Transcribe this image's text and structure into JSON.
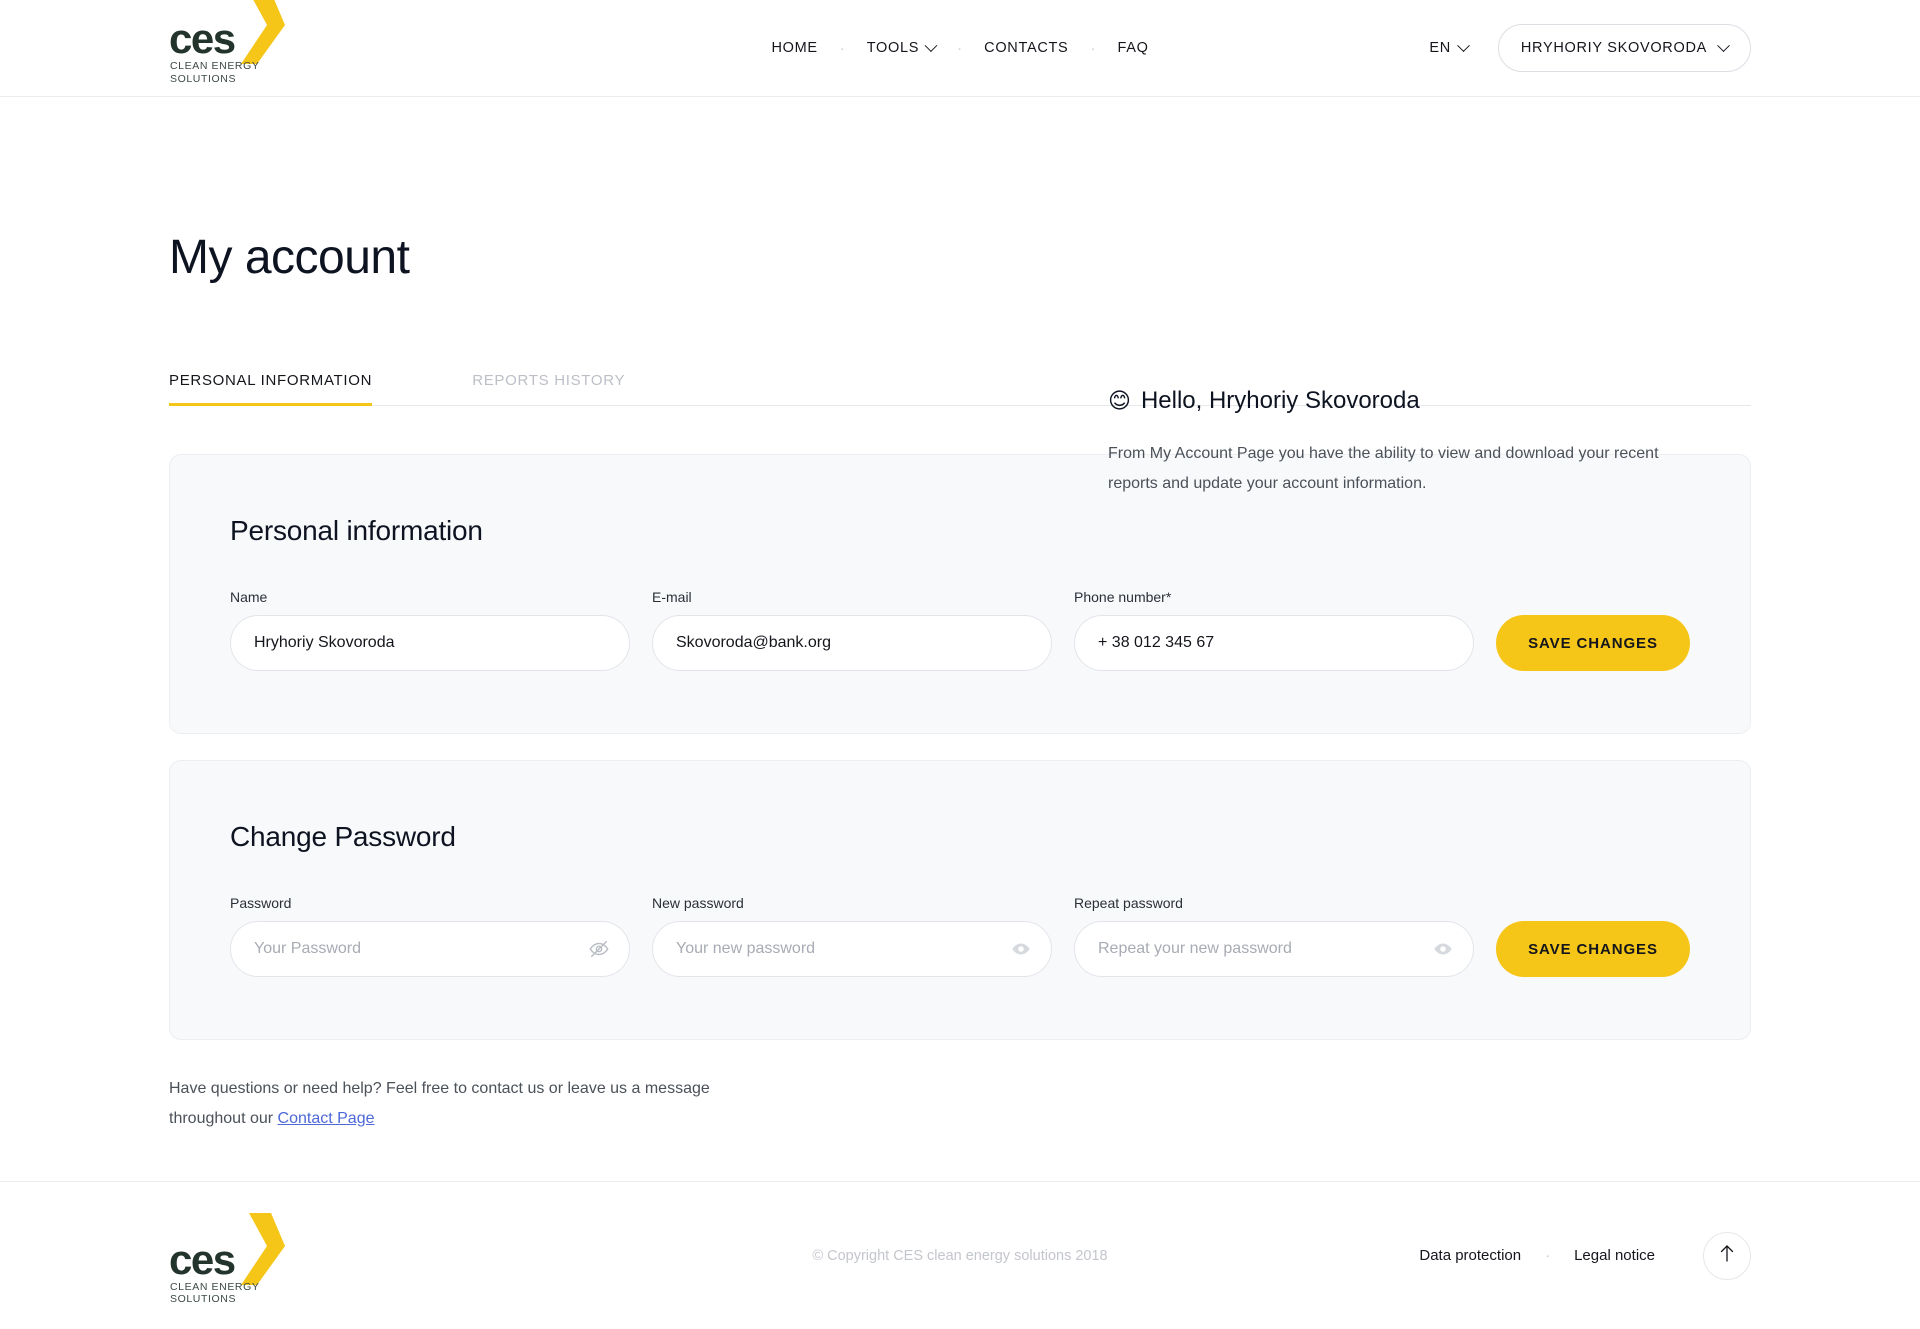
{
  "brand": {
    "logo_text": "ces",
    "logo_sub_line1": "CLEAN ENERGY",
    "logo_sub_line2": "SOLUTIONS",
    "accent_color": "#f5c518",
    "logo_dark": "#22342b"
  },
  "header": {
    "nav": [
      {
        "label": "HOME",
        "has_caret": false
      },
      {
        "label": "TOOLS",
        "has_caret": true
      },
      {
        "label": "CONTACTS",
        "has_caret": false
      },
      {
        "label": "FAQ",
        "has_caret": false
      }
    ],
    "separator": "·",
    "language": "EN",
    "user_button": "HRYHORIY SKOVORODA"
  },
  "main": {
    "page_title": "My account",
    "greeting_emoji": "😊",
    "greeting": "Hello, Hryhoriy Skovoroda",
    "greeting_description": "From My Account Page you have the ability to view and download your recent reports and update your account information.",
    "tabs": [
      {
        "label": "PERSONAL INFORMATION",
        "active": true
      },
      {
        "label": "REPORTS HISTORY",
        "active": false
      }
    ]
  },
  "personal_information": {
    "title": "Personal information",
    "fields": [
      {
        "label": "Name",
        "value": "Hryhoriy Skovoroda",
        "placeholder": ""
      },
      {
        "label": "E-mail",
        "value": "Skovoroda@bank.org",
        "placeholder": ""
      },
      {
        "label": "Phone number*",
        "value": "+ 38 012 345 67",
        "placeholder": ""
      }
    ],
    "save_label": "SAVE CHANGES"
  },
  "change_password": {
    "title": "Change Password",
    "fields": [
      {
        "label": "Password",
        "value": "",
        "placeholder": "Your Password",
        "icon": "eye-off-icon"
      },
      {
        "label": "New password",
        "value": "",
        "placeholder": "Your new password",
        "icon": "eye-icon"
      },
      {
        "label": "Repeat password",
        "value": "",
        "placeholder": "Repeat your new password",
        "icon": "eye-icon"
      }
    ],
    "save_label": "SAVE CHANGES"
  },
  "help": {
    "text_before": "Have questions or need help? Feel free to contact us or leave us a message throughout our ",
    "link_label": "Contact Page"
  },
  "footer": {
    "copyright": "© Copyright CES clean energy solutions 2018",
    "links": [
      {
        "label": "Data protection"
      },
      {
        "label": "Legal notice"
      }
    ],
    "separator": "·",
    "to_top_icon": "arrow-up-icon"
  }
}
